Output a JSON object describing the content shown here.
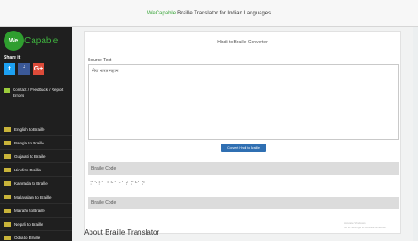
{
  "topbar": {
    "brand": "WeCapable",
    "title_rest": "Braille Translator for Indian Languages"
  },
  "sidebar": {
    "logo_badge": "We",
    "logo_word": "Capable",
    "share_label": "Share it",
    "social": {
      "twitter": "t",
      "facebook": "f",
      "google": "G+"
    },
    "contact_label": "Contact / Feedback / Report Errors",
    "items": [
      {
        "label": "English to Braille"
      },
      {
        "label": "Bangla to Braille"
      },
      {
        "label": "Gujarati to Braille"
      },
      {
        "label": "Hindi to Braille"
      },
      {
        "label": "Kannada to Braille"
      },
      {
        "label": "Malayalam to Braille"
      },
      {
        "label": "Marathi to Braille"
      },
      {
        "label": "Nepali to Braille"
      },
      {
        "label": "Odia to Braille"
      }
    ]
  },
  "panel": {
    "title": "Hindi to Braille Converter",
    "source_label": "Source Text",
    "source_value": "मेरा भारत महान",
    "convert_button": "Convert Hindi to Braille",
    "braille_code_label": "Braille Code",
    "braille_output": "⠍⠑⠗⠁ ⠃⠓⠁⠗⠁⠞ ⠍⠓⠁⠝",
    "braille_code_label_2": "Braille Code"
  },
  "about_heading": "About Braille Translator",
  "watermark": {
    "line1": "Activate Windows",
    "line2": "Go to Settings to activate Windows."
  }
}
